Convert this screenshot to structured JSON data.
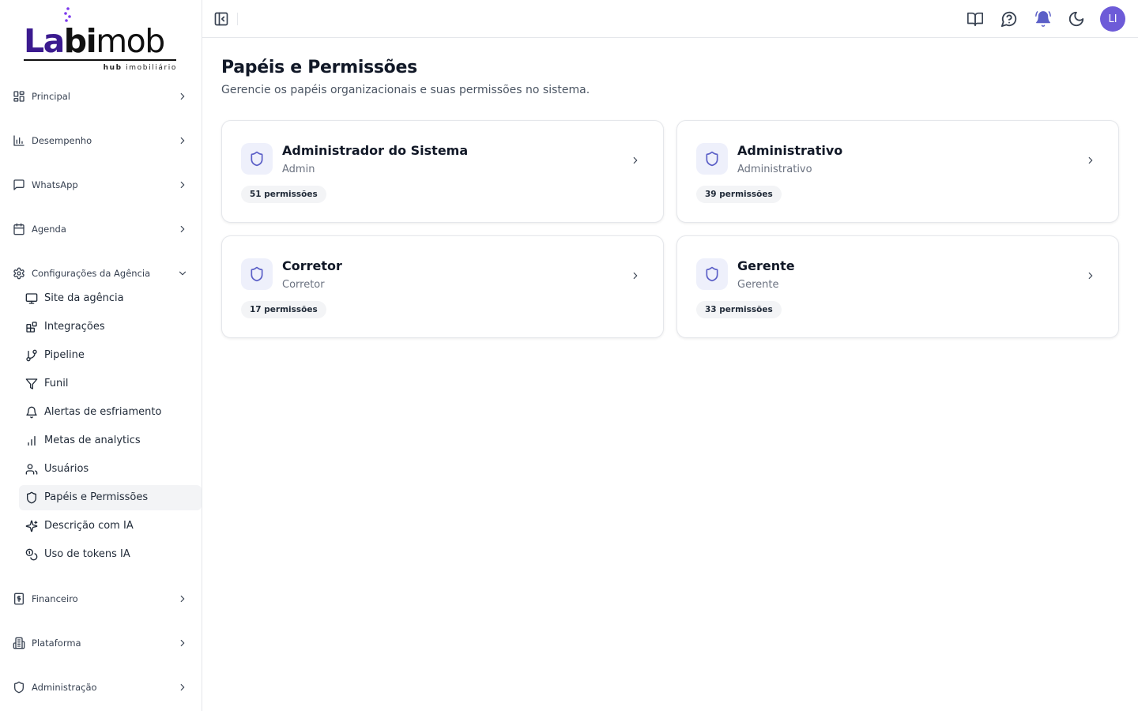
{
  "logo": {
    "part1": "La",
    "part2": "bi",
    "part3": "mob",
    "tagline_bold": "hub",
    "tagline_rest": " imobiliário"
  },
  "sidebar": {
    "groups": [
      {
        "label": "Principal",
        "icon": "layout-grid-icon"
      },
      {
        "label": "Desempenho",
        "icon": "bar-chart-icon"
      },
      {
        "label": "WhatsApp",
        "icon": "message-square-icon"
      },
      {
        "label": "Agenda",
        "icon": "calendar-icon"
      },
      {
        "label": "Configurações da Agência",
        "icon": "settings-icon"
      }
    ],
    "sub_items": [
      {
        "label": "Site da agência",
        "icon": "monitor-icon"
      },
      {
        "label": "Integrações",
        "icon": "blocks-icon"
      },
      {
        "label": "Pipeline",
        "icon": "git-branch-icon"
      },
      {
        "label": "Funil",
        "icon": "funnel-icon"
      },
      {
        "label": "Alertas de esfriamento",
        "icon": "bell-icon"
      },
      {
        "label": "Metas de analytics",
        "icon": "chart-icon"
      },
      {
        "label": "Usuários",
        "icon": "users-icon"
      },
      {
        "label": "Papéis e Permissões",
        "icon": "shield-icon",
        "active": true
      },
      {
        "label": "Descrição com IA",
        "icon": "sparkles-icon"
      },
      {
        "label": "Uso de tokens IA",
        "icon": "coins-icon"
      }
    ],
    "bottom_groups": [
      {
        "label": "Financeiro",
        "icon": "receipt-icon"
      },
      {
        "label": "Plataforma",
        "icon": "building-icon"
      },
      {
        "label": "Administração",
        "icon": "shield-icon"
      }
    ]
  },
  "topbar": {
    "avatar_initials": "LI"
  },
  "page": {
    "title": "Papéis e Permissões",
    "subtitle": "Gerencie os papéis organizacionais e suas permissões no sistema."
  },
  "roles": [
    {
      "title": "Administrador do Sistema",
      "subtitle": "Admin",
      "permissions": "51 permissões"
    },
    {
      "title": "Administrativo",
      "subtitle": "Administrativo",
      "permissions": "39 permissões"
    },
    {
      "title": "Corretor",
      "subtitle": "Corretor",
      "permissions": "17 permissões"
    },
    {
      "title": "Gerente",
      "subtitle": "Gerente",
      "permissions": "33 permissões"
    }
  ],
  "colors": {
    "brand": "#3b1a8f",
    "accent": "#6d5bd8",
    "icon_tint": "#5b5fc7",
    "bell": "#5b5fc7"
  }
}
